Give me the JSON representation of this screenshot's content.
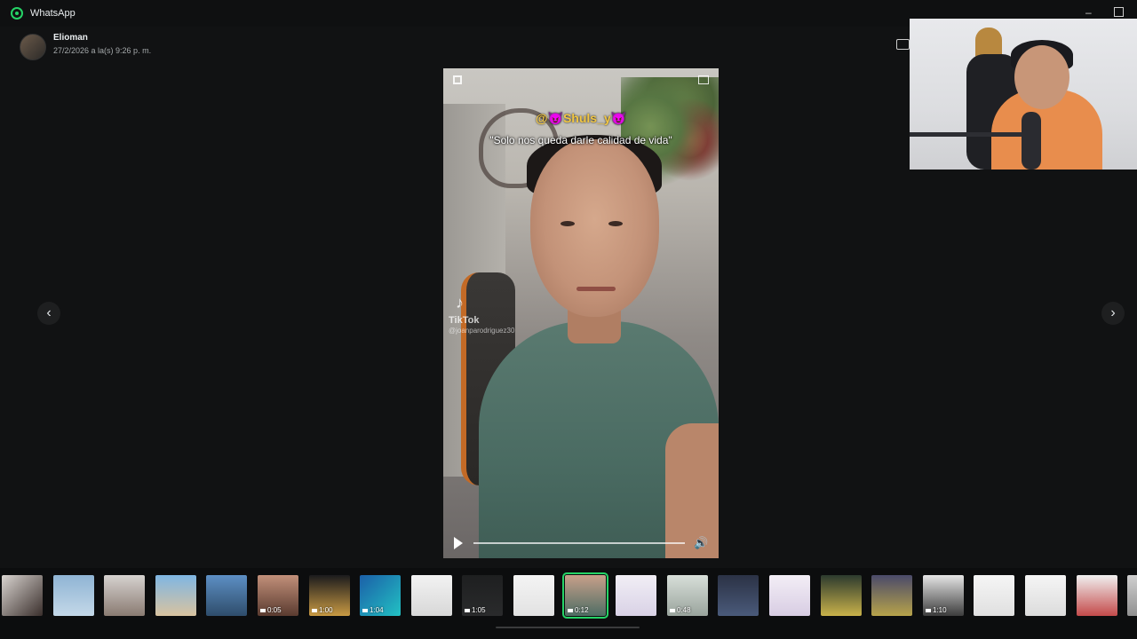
{
  "window": {
    "title": "WhatsApp"
  },
  "message": {
    "sender": "Elioman",
    "timestamp": "27/2/2026 a la(s) 9:26 p. m."
  },
  "video": {
    "caption_handle": "@😈Shuls_y😈",
    "caption_quote": "\"Solo nos queda darle calidad de vida\"",
    "watermark_brand": "TikTok",
    "watermark_user": "@joanparodriguez30",
    "progress": 0.0
  },
  "icons": {
    "prev": "‹",
    "next": "›",
    "minimize": "–",
    "volume": "🔊",
    "tiktok": "♪"
  },
  "thumbnails": [
    {
      "duration": "",
      "bg": "linear-gradient(135deg,#d9d4d0,#3a2f2c)"
    },
    {
      "duration": "",
      "bg": "linear-gradient(180deg,#8fb4d4,#c4d8e8)"
    },
    {
      "duration": "",
      "bg": "linear-gradient(180deg,#d6d2cf,#8a7b72)"
    },
    {
      "duration": "",
      "bg": "linear-gradient(180deg,#7fb6e3,#d9c3a0)"
    },
    {
      "duration": "",
      "bg": "linear-gradient(180deg,#5d8fc4,#2f4d6b)"
    },
    {
      "duration": "0:05",
      "bg": "linear-gradient(180deg,#c2907a,#5a3b30)"
    },
    {
      "duration": "1:00",
      "bg": "linear-gradient(180deg,#1b1b1d,#c99a43)"
    },
    {
      "duration": "1:04",
      "bg": "linear-gradient(135deg,#1b5fa8,#22c1c3)"
    },
    {
      "duration": "",
      "bg": "linear-gradient(180deg,#f2f2f2,#d8d8d8)"
    },
    {
      "duration": "1:05",
      "bg": "linear-gradient(180deg,#1e1f20,#2a2b2c)"
    },
    {
      "duration": "",
      "bg": "linear-gradient(180deg,#f4f4f4,#e2e2e2)"
    },
    {
      "duration": "0:12",
      "bg": "linear-gradient(180deg,#c8a08a,#4e6d64)"
    },
    {
      "duration": "",
      "bg": "linear-gradient(180deg,#f1eef5,#d9d2e6)"
    },
    {
      "duration": "0:48",
      "bg": "linear-gradient(180deg,#d8dfd9,#9aa49d)"
    },
    {
      "duration": "",
      "bg": "linear-gradient(180deg,#2b3245,#4a5a7a)"
    },
    {
      "duration": "",
      "bg": "linear-gradient(180deg,#f3eef6,#d8cde3)"
    },
    {
      "duration": "",
      "bg": "linear-gradient(180deg,#2c3a2e,#c9b24a)"
    },
    {
      "duration": "",
      "bg": "linear-gradient(180deg,#4a4a6a,#b7a34a)"
    },
    {
      "duration": "1:10",
      "bg": "linear-gradient(180deg,#e5e5e5,#3c3c3c)"
    },
    {
      "duration": "",
      "bg": "linear-gradient(180deg,#f5f5f5,#e0e0e0)"
    },
    {
      "duration": "",
      "bg": "linear-gradient(180deg,#f5f5f5,#dcdcdc)"
    },
    {
      "duration": "",
      "bg": "linear-gradient(180deg,#f0f0f0,#c44a4a)"
    },
    {
      "duration": "",
      "bg": "linear-gradient(180deg,#d0d0d0,#909090)"
    }
  ],
  "selected_thumbnail": 11,
  "colors": {
    "accent": "#25d366",
    "background": "#111213"
  }
}
